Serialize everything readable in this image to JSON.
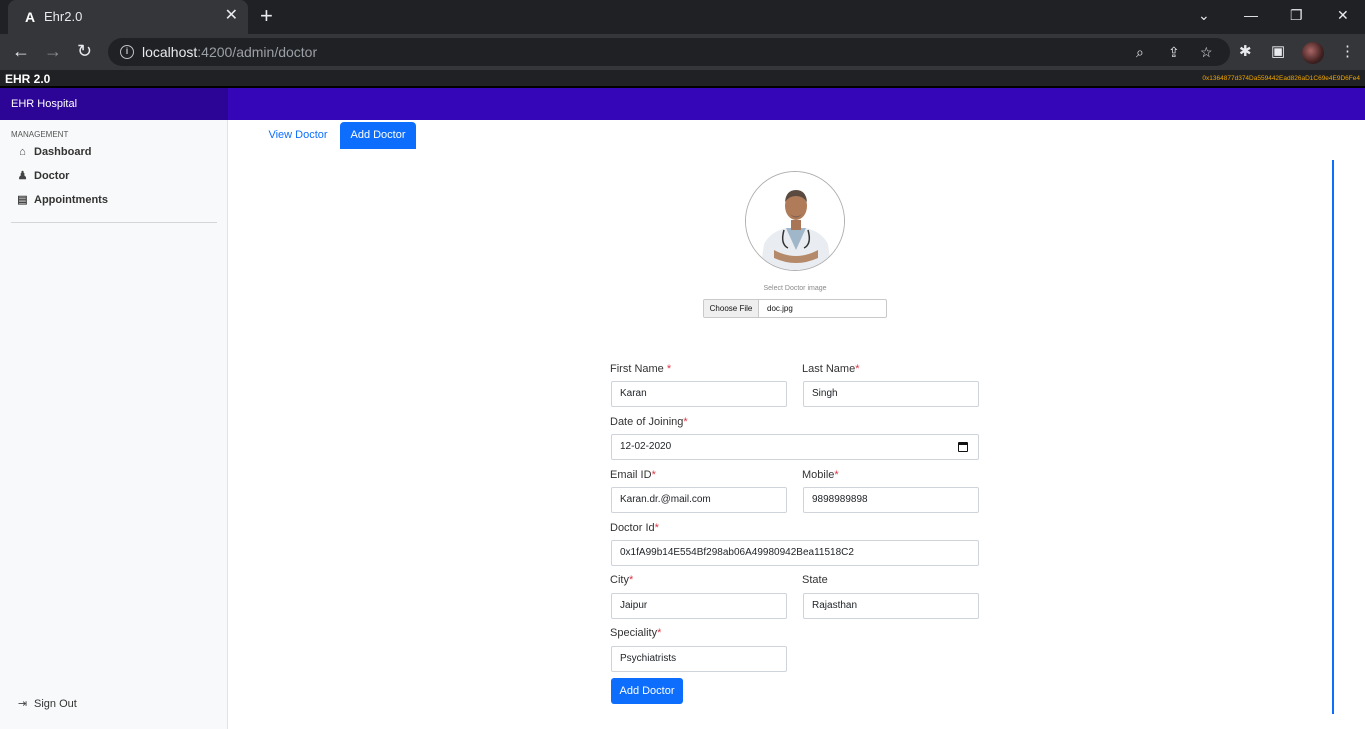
{
  "browser": {
    "tab_title": "Ehr2.0",
    "url_host": "localhost",
    "url_path": ":4200/admin/doctor"
  },
  "app": {
    "name": "EHR 2.0",
    "wallet_address": "0x1364877d374Da559442Ead826aD1C69e4E9D6Fe4",
    "brand": "EHR Hospital"
  },
  "sidebar": {
    "section_label": "MANAGEMENT",
    "items": [
      {
        "label": "Dashboard",
        "icon": "home-icon"
      },
      {
        "label": "Doctor",
        "icon": "user-icon"
      },
      {
        "label": "Appointments",
        "icon": "clipboard-icon"
      }
    ],
    "signout_label": "Sign Out"
  },
  "tabs": {
    "view_label": "View Doctor",
    "add_label": "Add Doctor"
  },
  "image_upload": {
    "caption": "Select Doctor image",
    "choose_label": "Choose File",
    "file_name": "doc.jpg"
  },
  "form": {
    "first_name": {
      "label": "First Name ",
      "value": "Karan",
      "required": "*"
    },
    "last_name": {
      "label": "Last Name",
      "value": "Singh",
      "required": "*"
    },
    "doj": {
      "label": "Date of Joining",
      "value": "12-02-2020",
      "required": "*"
    },
    "email": {
      "label": "Email ID",
      "value": "Karan.dr.@mail.com",
      "required": "*"
    },
    "mobile": {
      "label": "Mobile",
      "value": "9898989898",
      "required": "*"
    },
    "doctor_id": {
      "label": "Doctor Id",
      "value": "0x1fA99b14E554Bf298ab06A49980942Bea11518C2",
      "required": "*"
    },
    "city": {
      "label": "City",
      "value": "Jaipur",
      "required": "*"
    },
    "state": {
      "label": "State",
      "value": "Rajasthan"
    },
    "speciality": {
      "label": "Speciality",
      "value": "Psychiatrists",
      "required": "*"
    },
    "submit_label": "Add Doctor"
  },
  "colors": {
    "brand_bar": "#3506b8",
    "primary": "#0d6efd",
    "required": "#dc3545"
  }
}
